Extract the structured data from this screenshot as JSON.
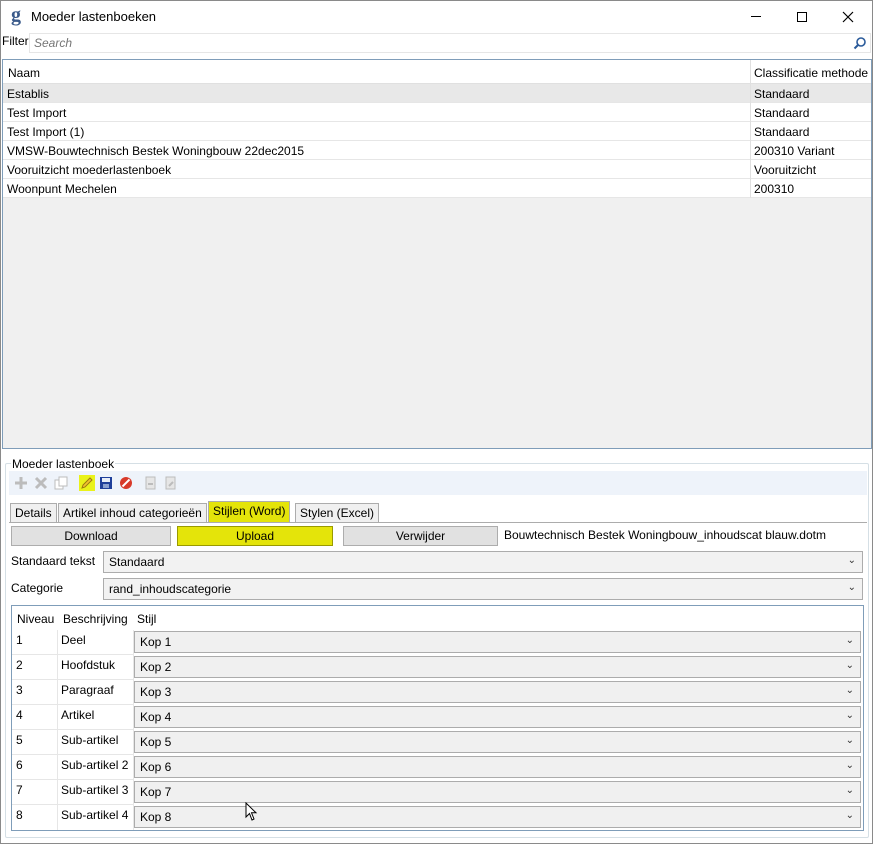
{
  "window": {
    "title": "Moeder lastenboeken",
    "minimize_label": "",
    "close_glyph": "✕"
  },
  "filter": {
    "label": "Filter",
    "placeholder": "Search"
  },
  "grid": {
    "columns": [
      "Naam",
      "Classificatie methode"
    ],
    "rows": [
      {
        "name": "Establis",
        "method": "Standaard"
      },
      {
        "name": "Test Import",
        "method": "Standaard"
      },
      {
        "name": "Test Import (1)",
        "method": "Standaard"
      },
      {
        "name": "VMSW-Bouwtechnisch Bestek Woningbouw 22dec2015",
        "method": "200310 Variant"
      },
      {
        "name": "Vooruitzicht moederlastenboek",
        "method": "Vooruitzicht"
      },
      {
        "name": "Woonpunt Mechelen",
        "method": "200310"
      }
    ]
  },
  "detail": {
    "group_title": "Moeder lastenboek",
    "tabs": [
      "Details",
      "Artikel inhoud categorieën",
      "Stijlen (Word)",
      "Stylen (Excel)"
    ],
    "active_tab": "Stijlen (Word)",
    "buttons": {
      "download": "Download",
      "upload": "Upload",
      "remove": "Verwijder"
    },
    "filename": "Bouwtechnisch Bestek Woningbouw_inhoudscat blauw.dotm",
    "standaard_tekst_label": "Standaard tekst",
    "standaard_tekst_value": "Standaard",
    "categorie_label": "Categorie",
    "categorie_value": "rand_inhoudscategorie",
    "levels_header": [
      "Niveau",
      "Beschrijving",
      "Stijl"
    ],
    "levels": [
      {
        "level": "1",
        "desc": "Deel",
        "style": "Kop 1"
      },
      {
        "level": "2",
        "desc": "Hoofdstuk",
        "style": "Kop 2"
      },
      {
        "level": "3",
        "desc": "Paragraaf",
        "style": "Kop 3"
      },
      {
        "level": "4",
        "desc": "Artikel",
        "style": "Kop 4"
      },
      {
        "level": "5",
        "desc": "Sub-artikel",
        "style": "Kop 5"
      },
      {
        "level": "6",
        "desc": "Sub-artikel 2",
        "style": "Kop 6"
      },
      {
        "level": "7",
        "desc": "Sub-artikel 3",
        "style": "Kop 7"
      },
      {
        "level": "8",
        "desc": "Sub-artikel 4",
        "style": "Kop 8"
      }
    ]
  },
  "colors": {
    "highlight": "#e4e40a",
    "grid_border": "#7f9db9",
    "toolbar_bg": "#eef3fa"
  },
  "icons": [
    "app-logo-icon",
    "search-icon",
    "add-icon",
    "delete-icon",
    "copy-icon",
    "edit-icon",
    "save-icon",
    "cancel-icon",
    "import-icon",
    "export-icon",
    "chevron-down-icon"
  ]
}
